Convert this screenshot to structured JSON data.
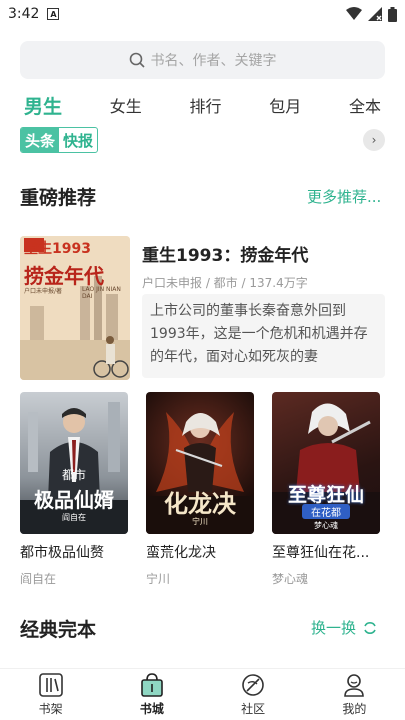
{
  "status_bar": {
    "time": "3:42",
    "notification_glyph": "A"
  },
  "search": {
    "placeholder": "书名、作者、关键字"
  },
  "tabs": [
    {
      "label": "男生",
      "active": true
    },
    {
      "label": "女生",
      "active": false
    },
    {
      "label": "排行",
      "active": false
    },
    {
      "label": "包月",
      "active": false
    },
    {
      "label": "全本",
      "active": false
    }
  ],
  "news_badge": {
    "part1": "头条",
    "part2": "快报"
  },
  "recommend": {
    "title": "重磅推荐",
    "more": "更多推荐..."
  },
  "featured": {
    "title": "重生1993：捞金年代",
    "meta": "户口未申报 / 都市 / 137.4万字",
    "description": "上市公司的董事长秦奋意外回到1993年，这是一个危机和机遇并存的年代，面对心如死灰的妻",
    "cover_text": {
      "top": "重生1993",
      "main": "捞金年代",
      "author": "户口未申报/著",
      "pinyin": "LAO JIN NIAN DAI"
    }
  },
  "books": [
    {
      "title": "都市极品仙赘",
      "author": "阎自在",
      "cover_line1": "都市",
      "cover_line2": "极品仙婿",
      "cover_author": "阎自在"
    },
    {
      "title": "蛮荒化龙决",
      "author": "宁川",
      "cover_line1": "化龙决",
      "cover_line2": "",
      "cover_author": "宁川"
    },
    {
      "title": "至尊狂仙在花...",
      "author": "梦心魂",
      "cover_line1": "至尊狂仙",
      "cover_line2": "在花都",
      "cover_author": "梦心魂"
    }
  ],
  "classic": {
    "title": "经典完本",
    "refresh": "换一换"
  },
  "bottom_nav": [
    {
      "label": "书架",
      "icon": "bookshelf-icon",
      "active": false
    },
    {
      "label": "书城",
      "icon": "bookstore-icon",
      "active": true
    },
    {
      "label": "社区",
      "icon": "community-icon",
      "active": false
    },
    {
      "label": "我的",
      "icon": "profile-icon",
      "active": false
    }
  ],
  "colors": {
    "accent": "#2fb38f",
    "muted_text": "#9a9a9a",
    "search_bg": "#f1f2f4"
  }
}
